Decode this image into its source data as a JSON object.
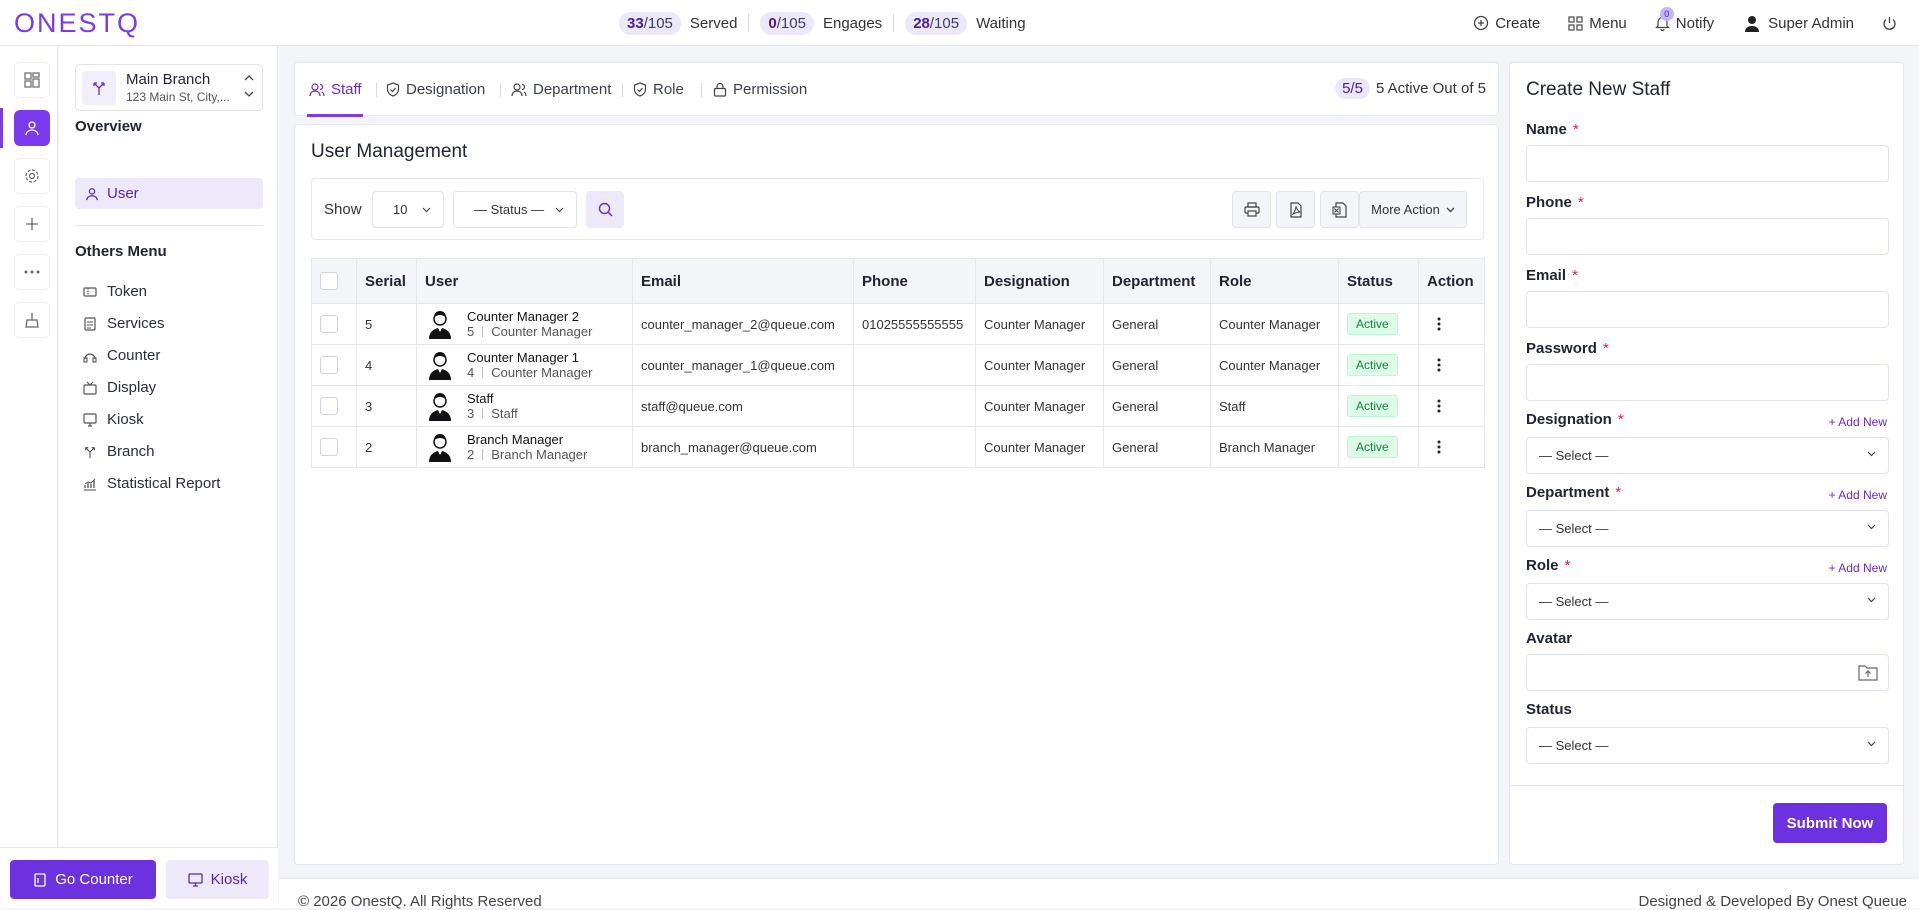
{
  "app": {
    "logo": "ONESTQ"
  },
  "stats": [
    {
      "value": "33",
      "total": "/105",
      "label": "Served"
    },
    {
      "value": "0",
      "total": "/105",
      "label": "Engages"
    },
    {
      "value": "28",
      "total": "/105",
      "label": "Waiting"
    }
  ],
  "top_actions": {
    "create": "Create",
    "menu": "Menu",
    "notify": "Notify",
    "notify_count": "0",
    "user": "Super Admin"
  },
  "branch": {
    "name": "Main Branch",
    "address": "123 Main St, City,..."
  },
  "sidebar": {
    "overview_title": "Overview",
    "active_item": "User",
    "others_title": "Others Menu",
    "items": [
      {
        "label": "Token",
        "icon": "token-icon"
      },
      {
        "label": "Services",
        "icon": "services-icon"
      },
      {
        "label": "Counter",
        "icon": "counter-icon"
      },
      {
        "label": "Display",
        "icon": "display-icon"
      },
      {
        "label": "Kiosk",
        "icon": "kiosk-icon"
      },
      {
        "label": "Branch",
        "icon": "branch-icon"
      },
      {
        "label": "Statistical Report",
        "icon": "report-icon"
      }
    ],
    "go_counter": "Go Counter",
    "kiosk": "Kiosk"
  },
  "tabs": [
    {
      "label": "Staff",
      "active": true
    },
    {
      "label": "Designation"
    },
    {
      "label": "Department"
    },
    {
      "label": "Role"
    },
    {
      "label": "Permission"
    }
  ],
  "active_count": {
    "pill": "5/5",
    "label": "5 Active Out of 5"
  },
  "main": {
    "title": "User Management",
    "show_label": "Show",
    "page_size": "10",
    "status_filter": "— Status —",
    "more_action": "More Action",
    "columns": [
      "Serial",
      "User",
      "Email",
      "Phone",
      "Designation",
      "Department",
      "Role",
      "Status",
      "Action"
    ],
    "rows": [
      {
        "serial": "5",
        "name": "Counter Manager 2",
        "id": "5",
        "sub": "Counter Manager",
        "email": "counter_manager_2@queue.com",
        "phone": "01025555555555",
        "designation": "Counter Manager",
        "department": "General",
        "role": "Counter Manager",
        "status": "Active"
      },
      {
        "serial": "4",
        "name": "Counter Manager 1",
        "id": "4",
        "sub": "Counter Manager",
        "email": "counter_manager_1@queue.com",
        "phone": "",
        "designation": "Counter Manager",
        "department": "General",
        "role": "Counter Manager",
        "status": "Active"
      },
      {
        "serial": "3",
        "name": "Staff",
        "id": "3",
        "sub": "Staff",
        "email": "staff@queue.com",
        "phone": "",
        "designation": "Counter Manager",
        "department": "General",
        "role": "Staff",
        "status": "Active"
      },
      {
        "serial": "2",
        "name": "Branch Manager",
        "id": "2",
        "sub": "Branch Manager",
        "email": "branch_manager@queue.com",
        "phone": "",
        "designation": "Counter Manager",
        "department": "General",
        "role": "Branch Manager",
        "status": "Active"
      }
    ]
  },
  "form": {
    "title": "Create New Staff",
    "name": "Name",
    "phone": "Phone",
    "email": "Email",
    "password": "Password",
    "designation": "Designation",
    "department": "Department",
    "role": "Role",
    "avatar": "Avatar",
    "status": "Status",
    "required_mark": "*",
    "add_new": "+ Add New",
    "select_placeholder": "— Select —",
    "submit": "Submit Now"
  },
  "footer": {
    "left": "© 2026 OnestQ. All Rights Reserved",
    "right": "Designed & Developed By Onest Queue"
  },
  "colors": {
    "accent": "#7c3aed",
    "active_badge": "#15803d"
  }
}
